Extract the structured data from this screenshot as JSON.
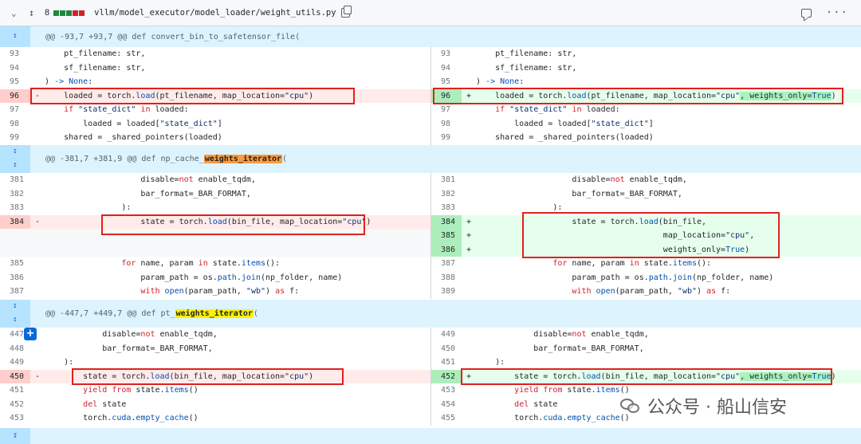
{
  "file": {
    "changes": "8",
    "path": "vllm/model_executor/model_loader/weight_utils.py",
    "diffstat_colors": [
      "#1f883d",
      "#1f883d",
      "#1f883d",
      "#cf222e",
      "#cf222e"
    ]
  },
  "hunks": [
    {
      "pre": "@@ -93,7 +93,7 @@ def convert_bin_to_safetensor_file(",
      "hl": "",
      "post": ""
    },
    {
      "pre": "@@ -381,7 +381,9 @@ def np_cache_",
      "hl": "weights_iterator",
      "post": "("
    },
    {
      "pre": "@@ -447,7 +449,7 @@ def pt_",
      "hl": "weights_iterator",
      "post": "("
    }
  ],
  "lines": {
    "h1": {
      "l93": "93",
      "l94": "94",
      "l95": "95",
      "l96": "96",
      "l97": "97",
      "l98": "98",
      "l99": "99",
      "c93": "    pt_filename: str,",
      "c94": "    sf_filename: str,",
      "c95a": ") ",
      "c95b": "-> None",
      "c95c": ":",
      "c96del_a": "    loaded = torch.",
      "c96del_b": "load",
      "c96del_c": "(pt_filename, map_location=",
      "c96del_d": "\"cpu\"",
      "c96del_e": ")",
      "c96add_e": ", weights_only=",
      "c96add_f": "True",
      "c96add_g": ")",
      "c97a": "    ",
      "c97b": "if",
      "c97c": " ",
      "c97d": "\"state_dict\"",
      "c97e": " ",
      "c97f": "in",
      "c97g": " loaded:",
      "c98a": "        loaded = loaded[",
      "c98b": "\"state_dict\"",
      "c98c": "]",
      "c99a": "    shared = _shared_pointers(loaded)"
    },
    "h2": {
      "l381": "381",
      "l382": "382",
      "l383": "383",
      "l384": "384",
      "l385": "385",
      "l386": "386",
      "l387": "387",
      "r381": "381",
      "r382": "382",
      "r383": "383",
      "r384": "384",
      "r385": "385",
      "r386": "386",
      "r387": "387",
      "r388": "388",
      "r389": "389",
      "c381a": "                    disable=",
      "c381b": "not",
      "c381c": " enable_tqdm,",
      "c382": "                    bar_format=_BAR_FORMAT,",
      "c383": "                ):",
      "c384del_a": "                    state = torch.",
      "c384del_b": "load",
      "c384del_c": "(bin_file, map_location=",
      "c384del_d": "\"cpu\"",
      "c384del_e": ")",
      "c384add": "(bin_file,",
      "c385add_a": "                                       map_location=",
      "c385add_b": "\"cpu\"",
      "c385add_c": ",",
      "c386add_a": "                                       weights_only=",
      "c386add_b": "True",
      "c386add_c": ")",
      "c385a": "                ",
      "c385b": "for",
      "c385c": " name, param ",
      "c385d": "in",
      "c385e": " state.",
      "c385f": "items",
      "c385g": "():",
      "c386a": "                    param_path = os.",
      "c386b": "path",
      "c386c": ".",
      "c386d": "join",
      "c386e": "(np_folder, name)",
      "c387a": "                    ",
      "c387b": "with",
      "c387c": " ",
      "c387d": "open",
      "c387e": "(param_path, ",
      "c387f": "\"wb\"",
      "c387g": ") ",
      "c387h": "as",
      "c387i": " f:"
    },
    "h3": {
      "l447": "447",
      "l448": "448",
      "l449": "449",
      "l450": "450",
      "l451": "451",
      "l452": "452",
      "l453": "453",
      "r449": "449",
      "r450": "450",
      "r451": "451",
      "r452": "452",
      "r453": "453",
      "r454": "454",
      "r455": "455",
      "c447a": "            disable=",
      "c447b": "not",
      "c447c": " enable_tqdm,",
      "c448": "            bar_format=_BAR_FORMAT,",
      "c449": "    ):",
      "c450a": "        state = torch.",
      "c450b": "load",
      "c450c": "(bin_file, map_location=",
      "c450d": "\"cpu\"",
      "c450e": ")",
      "c450add_e": ", weights_only=",
      "c450add_f": "True",
      "c450add_g": ")",
      "c451a": "        ",
      "c451b": "yield",
      "c451c": " ",
      "c451d": "from",
      "c451e": " state.",
      "c451f": "items",
      "c451g": "()",
      "c452a": "        ",
      "c452b": "del",
      "c452c": " state",
      "c453a": "        torch.",
      "c453b": "cuda",
      "c453c": ".",
      "c453d": "empty_cache",
      "c453e": "()"
    }
  },
  "signs": {
    "del": "-",
    "add": "+"
  },
  "watermark": "公众号 · 船山信安"
}
